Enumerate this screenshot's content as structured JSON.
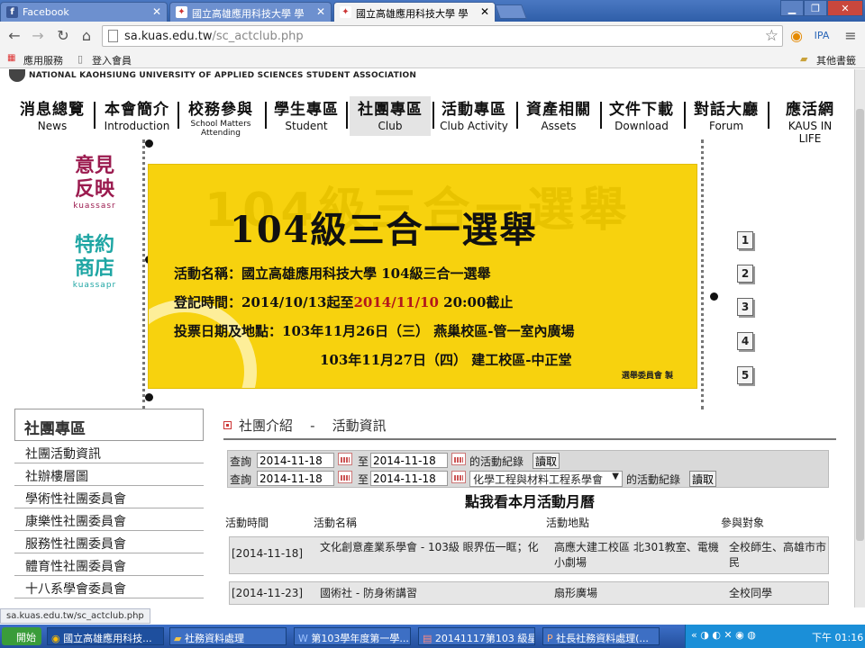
{
  "browser": {
    "tabs": [
      {
        "label": "Facebook",
        "active": false
      },
      {
        "label": "國立高雄應用科技大學 學",
        "active": false
      },
      {
        "label": "國立高雄應用科技大學 學",
        "active": true
      }
    ],
    "url_host": "sa.kuas.edu.tw",
    "url_path": "/sc_actclub.php",
    "bookmarks": {
      "apps": "應用服務",
      "login": "登入會員",
      "other": "其他書籤"
    },
    "status_url": "sa.kuas.edu.tw/sc_actclub.php"
  },
  "site": {
    "org_name": "NATIONAL KAOHSIUNG UNIVERSITY OF APPLIED SCIENCES STUDENT ASSOCIATION",
    "nav": [
      {
        "zh": "消息總覽",
        "en": "News"
      },
      {
        "zh": "本會簡介",
        "en": "Introduction"
      },
      {
        "zh": "校務參與",
        "en": "School Matters Attending"
      },
      {
        "zh": "學生專區",
        "en": "Student"
      },
      {
        "zh": "社團專區",
        "en": "Club"
      },
      {
        "zh": "活動專區",
        "en": "Club Activity"
      },
      {
        "zh": "資產相關",
        "en": "Assets"
      },
      {
        "zh": "文件下載",
        "en": "Download"
      },
      {
        "zh": "對話大廳",
        "en": "Forum"
      },
      {
        "zh": "應活網",
        "en": "KAUS IN LIFE"
      }
    ],
    "badges": [
      {
        "line1": "意見",
        "line2": "反映",
        "sub": "kuassasr",
        "color": "#9b1b4f"
      },
      {
        "line1": "特約",
        "line2": "商店",
        "sub": "kuassapr",
        "color": "#1fa6a4"
      }
    ]
  },
  "banner": {
    "ghost_text": "104級三合一選舉",
    "headline": "104級三合一選舉",
    "line1": "活動名稱：國立高雄應用科技大學 104級三合一選舉",
    "line2_a": "登記時間：2014/10/13起至",
    "line2_red": "2014/11/10",
    "line2_b": " 20:00截止",
    "line3": "投票日期及地點：103年11月26日（三） 燕巢校區-管一室內廣場",
    "line4": "103年11月27日（四） 建工校區-中正堂",
    "signature": "選舉委員會 製",
    "slides": [
      "1",
      "2",
      "3",
      "4",
      "5"
    ],
    "active_slide": 3
  },
  "sidebar": {
    "title": "社團專區",
    "items": [
      "社團活動資訊",
      "社辦樓層圖",
      "學術性社團委員會",
      "康樂性社團委員會",
      "服務性社團委員會",
      "體育性社團委員會",
      "十八系學會委員會"
    ]
  },
  "content": {
    "crumb_section": "社團介紹",
    "crumb_sep": "-",
    "crumb_page": "活動資訊",
    "filter1": {
      "label": "查詢",
      "from": "2014-11-18",
      "to_label": "至",
      "to": "2014-11-18",
      "suffix": "的活動紀錄",
      "button": "讀取"
    },
    "filter2": {
      "label": "查詢",
      "from": "2014-11-18",
      "to_label": "至",
      "to": "2014-11-18",
      "club": "化學工程與材料工程系學會",
      "suffix": "的活動紀錄",
      "button": "讀取"
    },
    "calendar_link": "點我看本月活動月曆",
    "columns": [
      "活動時間",
      "活動名稱",
      "活動地點",
      "參與對象"
    ],
    "rows": [
      {
        "date": "[2014-11-18]",
        "name": "文化創意產業系學會 - 103級 眼界伍一眶；化",
        "place": "高應大建工校區 北301教室、電機小劇場",
        "target": "全校師生、高雄市市民"
      },
      {
        "date": "[2014-11-23]",
        "name": "國術社 - 防身術講習",
        "place": "扇形廣場",
        "target": "全校同學"
      }
    ]
  },
  "taskbar": {
    "start": "開始",
    "items": [
      "國立高雄應用科技...",
      "社務資料處理",
      "第103學年度第一學...",
      "20141117第103 級星...",
      "社長社務資料處理(..."
    ],
    "clock": "下午 01:16"
  }
}
